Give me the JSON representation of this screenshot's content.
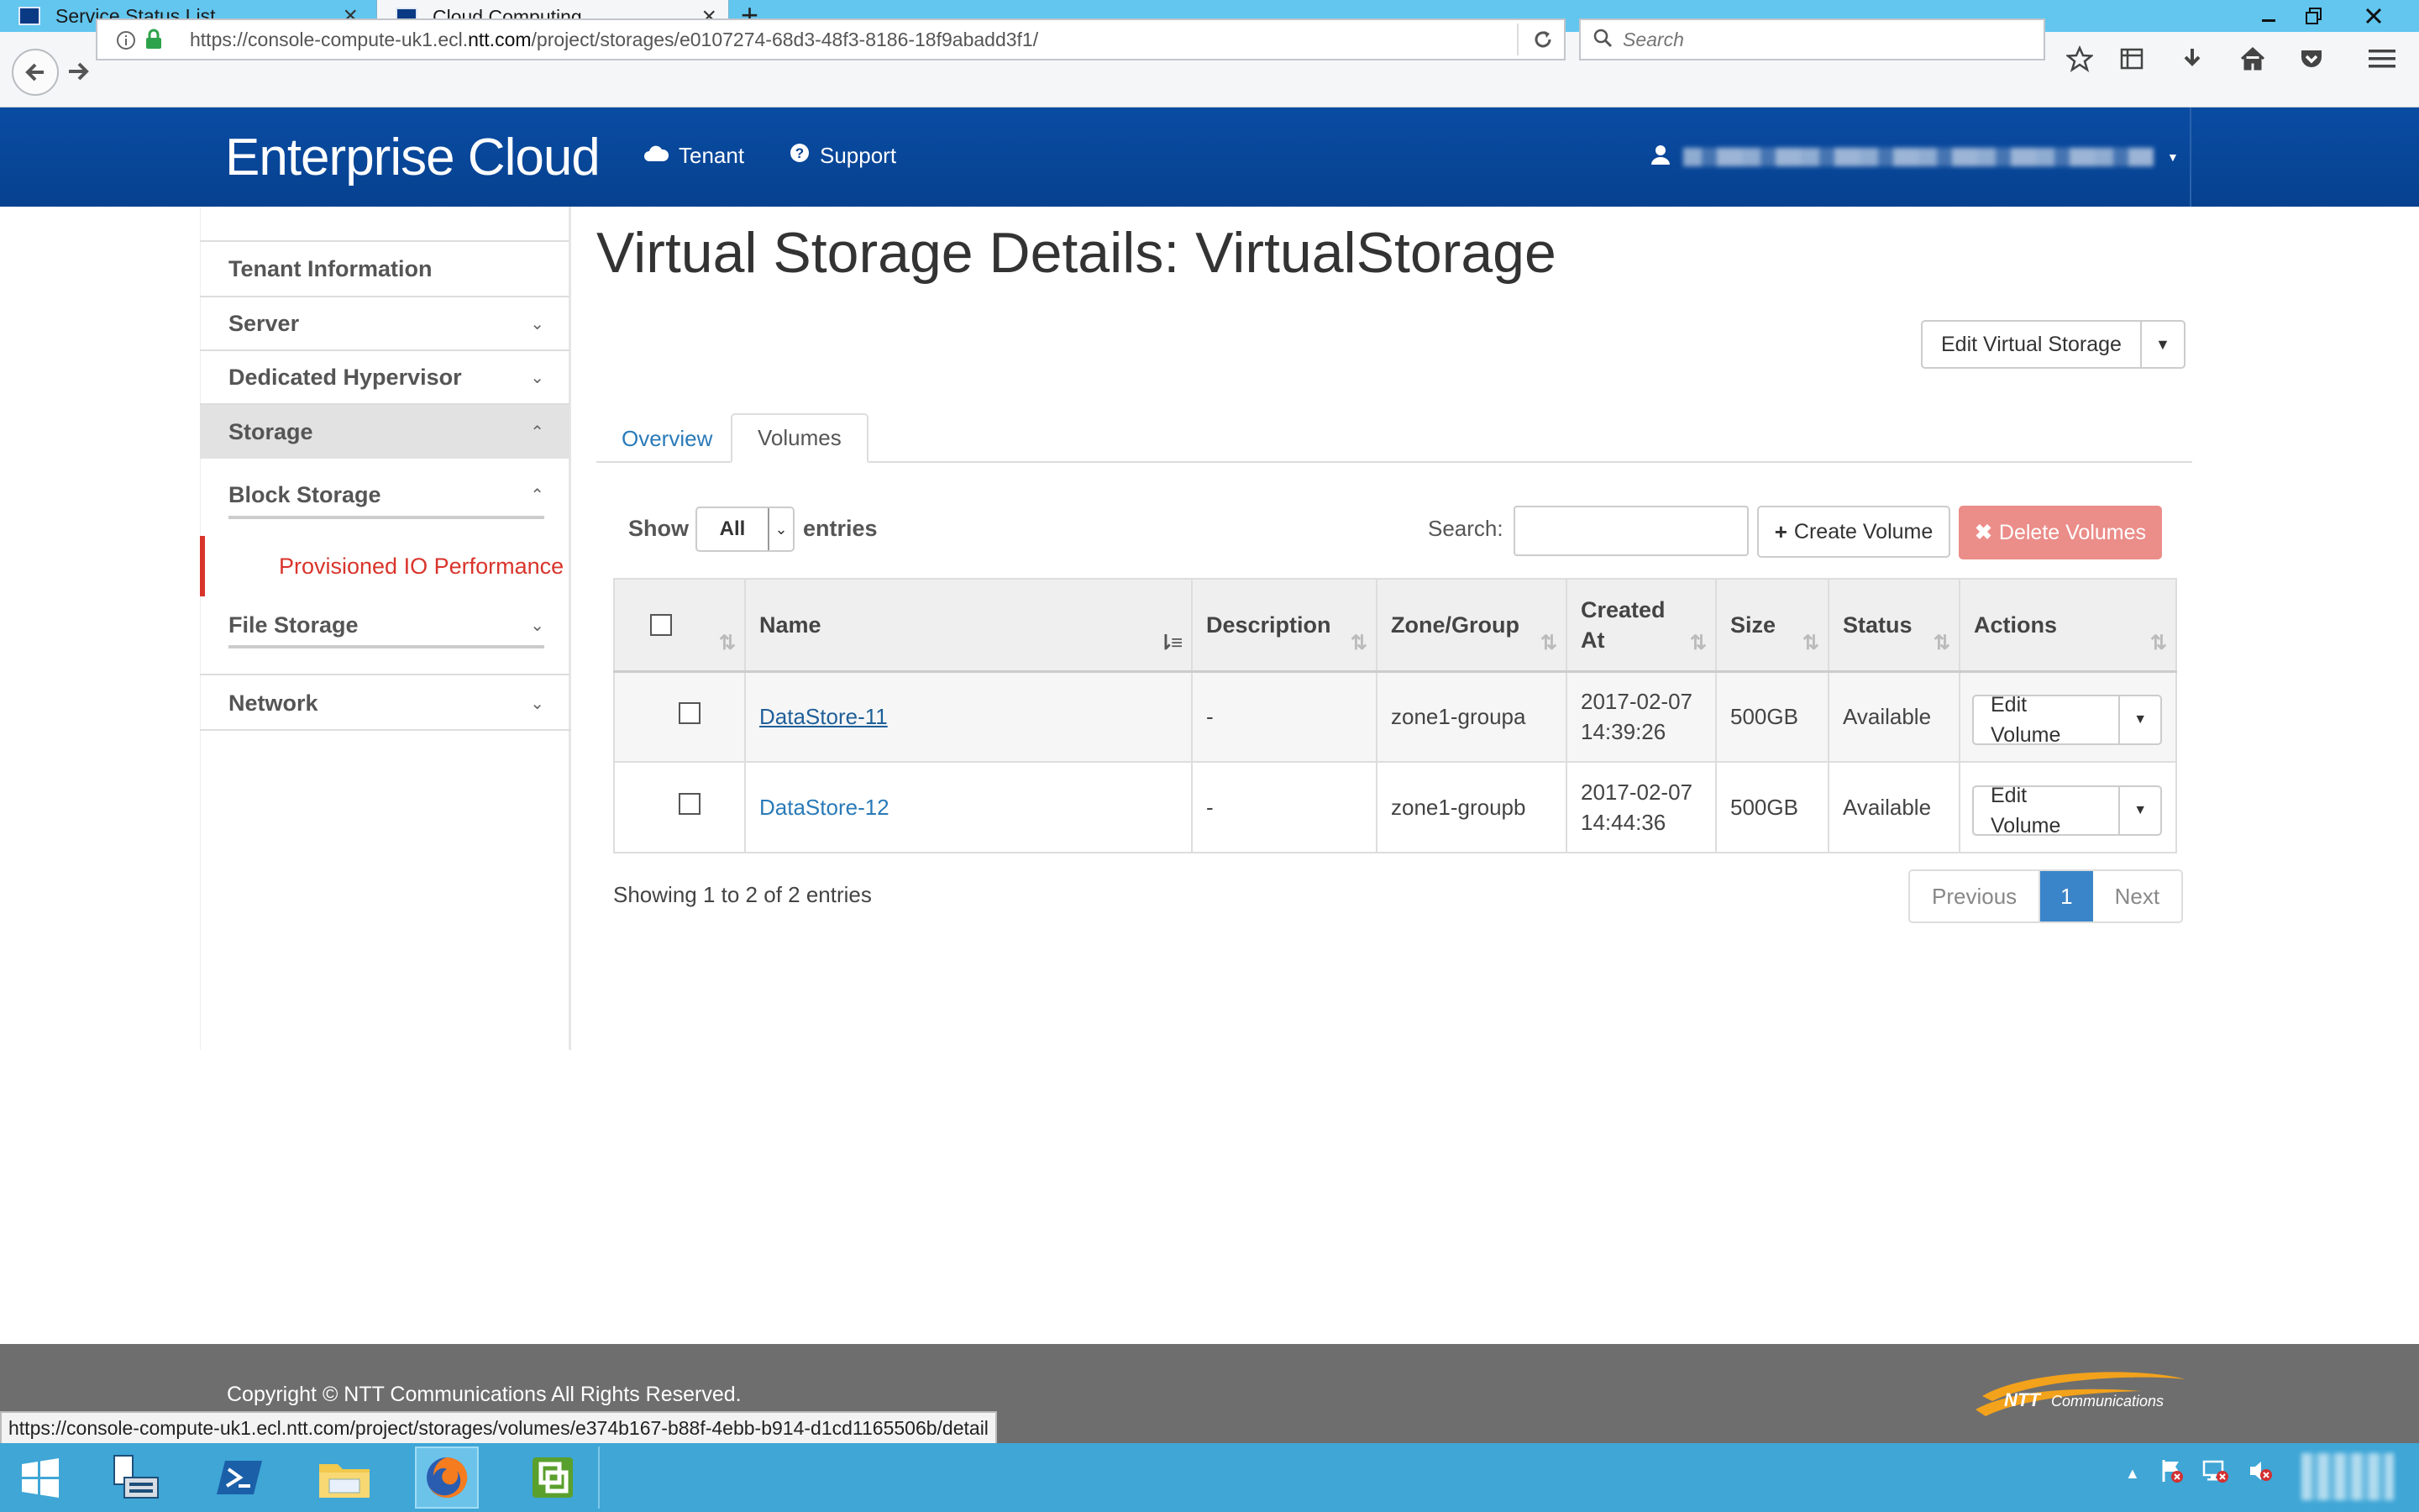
{
  "browser": {
    "tabs": [
      {
        "label": "Service Status List",
        "active": false
      },
      {
        "label": "Cloud Computing",
        "active": true
      }
    ],
    "url_prefix": "https://console-compute-uk1.ecl.",
    "url_domain": "ntt.com",
    "url_path": "/project/storages/e0107274-68d3-48f3-8186-18f9abadd3f1/",
    "search_placeholder": "Search",
    "status_url": "https://console-compute-uk1.ecl.ntt.com/project/storages/volumes/e374b167-b88f-4ebb-b914-d1cd1165506b/detail",
    "tab_bar_color": "#62c6ef"
  },
  "header": {
    "brand": "Enterprise Cloud",
    "nav": [
      {
        "label": "Tenant",
        "icon": "cloud-icon"
      },
      {
        "label": "Support",
        "icon": "question-icon"
      }
    ],
    "user_icon": "user-icon",
    "color": "#06418f"
  },
  "sidebar": {
    "items": [
      {
        "label": "Tenant Information",
        "chevron": ""
      },
      {
        "label": "Server",
        "chevron": "⌄"
      },
      {
        "label": "Dedicated Hypervisor",
        "chevron": "⌄"
      },
      {
        "label": "Storage",
        "chevron": "⌃"
      },
      {
        "label": "Block Storage",
        "chevron": "⌃"
      },
      {
        "label": "Provisioned IO Performance",
        "chevron": ""
      },
      {
        "label": "File Storage",
        "chevron": "⌄"
      },
      {
        "label": "Network",
        "chevron": "⌄"
      }
    ],
    "active_color": "#d9342b"
  },
  "page": {
    "title": "Virtual Storage Details: VirtualStorage",
    "edit_button": "Edit Virtual Storage",
    "tabs": [
      "Overview",
      "Volumes"
    ],
    "active_tab": "Volumes"
  },
  "table_controls": {
    "show_label": "Show",
    "show_value": "All",
    "entries_label": "entries",
    "search_label": "Search:",
    "create_button": "Create Volume",
    "delete_button": "Delete Volumes",
    "delete_color": "#eb8d89"
  },
  "table": {
    "columns": [
      "Name",
      "Description",
      "Zone/Group",
      "Created At",
      "Size",
      "Status",
      "Actions"
    ],
    "rows": [
      {
        "name": "DataStore-11",
        "description": "-",
        "zone": "zone1-groupa",
        "created_date": "2017-02-07",
        "created_time": "14:39:26",
        "size": "500GB",
        "status": "Available",
        "action": "Edit Volume"
      },
      {
        "name": "DataStore-12",
        "description": "-",
        "zone": "zone1-groupb",
        "created_date": "2017-02-07",
        "created_time": "14:44:36",
        "size": "500GB",
        "status": "Available",
        "action": "Edit Volume"
      }
    ],
    "info": "Showing 1 to 2 of 2 entries",
    "pagination": {
      "previous": "Previous",
      "current": "1",
      "next": "Next"
    }
  },
  "footer": {
    "copyright": "Copyright © NTT Communications All Rights Reserved.",
    "logo_text": "NTT Communications"
  }
}
